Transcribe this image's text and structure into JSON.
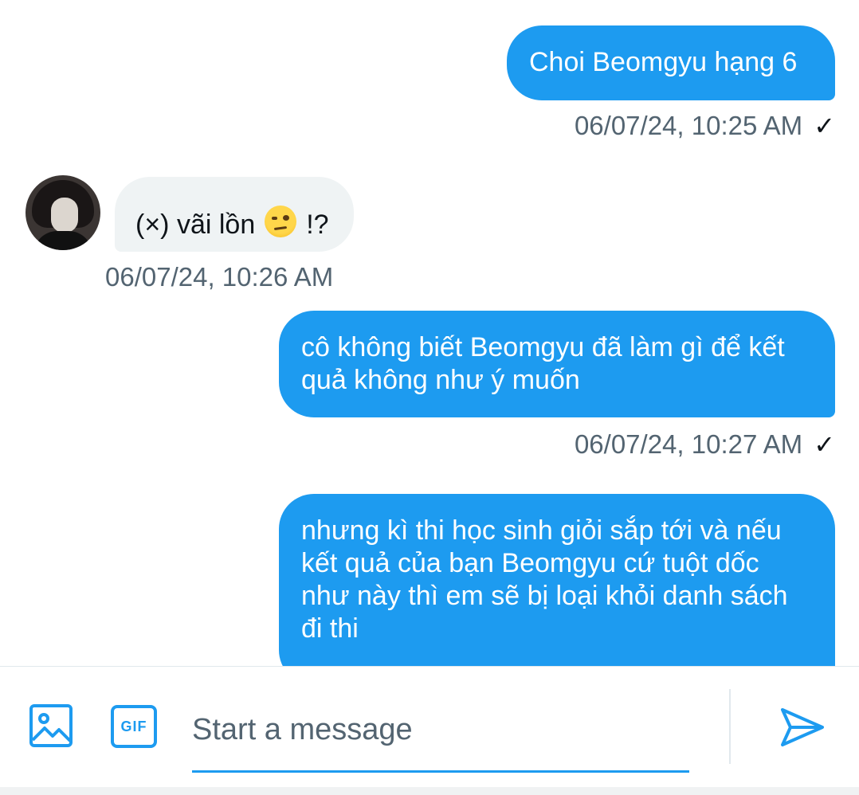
{
  "messages": [
    {
      "direction": "outgoing",
      "text": "Choi Beomgyu hạng 6",
      "timestamp": "06/07/24, 10:25 AM",
      "status": "✓"
    },
    {
      "direction": "incoming",
      "text_before": "(×) vãi lồn",
      "emoji": "face-with-raised-eyebrow",
      "text_after": "!?",
      "timestamp": "06/07/24, 10:26 AM"
    },
    {
      "direction": "outgoing",
      "text": "cô không biết Beomgyu đã làm gì để kết quả không như ý muốn",
      "timestamp": "06/07/24, 10:27 AM",
      "status": "✓"
    },
    {
      "direction": "outgoing",
      "text": "nhưng kì thi học sinh giỏi sắp tới và nếu kết quả của bạn Beomgyu cứ tuột dốc như này thì em sẽ bị loại khỏi danh sách đi thi"
    }
  ],
  "composer": {
    "placeholder": "Start a message",
    "gif_label": "GIF",
    "icons": [
      "image-icon",
      "gif-icon",
      "send-icon"
    ]
  },
  "colors": {
    "accent": "#1d9bf0",
    "incoming_bubble": "#eff3f4",
    "timestamp": "#536471"
  }
}
